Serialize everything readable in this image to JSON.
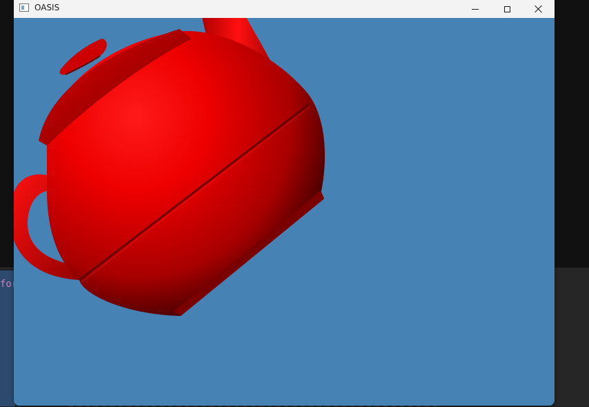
{
  "window": {
    "title": "OASIS",
    "icon": "app-window-icon",
    "controls": {
      "minimize": "minimize-icon",
      "maximize": "maximize-icon",
      "close": "close-icon"
    }
  },
  "viewport": {
    "background_color": "#4682b4",
    "object": "teapot",
    "object_color": "#ff0000"
  },
  "background_editor": {
    "visible_text": "for"
  }
}
